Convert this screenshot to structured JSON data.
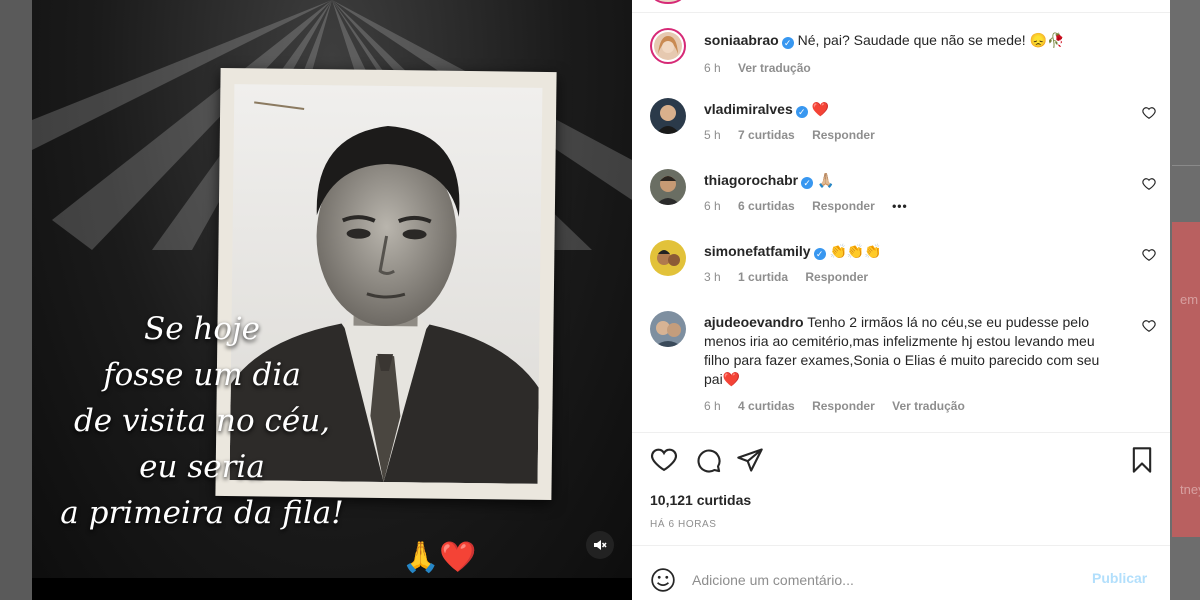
{
  "post": {
    "author": "soniaabrao",
    "caption": "Né, pai? Saudade que não se mede! 😞🥀",
    "time": "6 h",
    "translate": "Ver tradução",
    "overlay_lines": [
      "Se hoje",
      "fosse um dia",
      "de visita no céu,",
      "eu seria",
      "a primeira da fila!"
    ],
    "emojis": "🙏❤️"
  },
  "comments": [
    {
      "username": "vladimiralves",
      "verified": true,
      "text": "❤️",
      "time": "5 h",
      "likes": "7 curtidas",
      "reply": "Responder",
      "extra": ""
    },
    {
      "username": "thiagorochabr",
      "verified": true,
      "text": "🙏🏼",
      "time": "6 h",
      "likes": "6 curtidas",
      "reply": "Responder",
      "extra": "•••"
    },
    {
      "username": "simonefatfamily",
      "verified": true,
      "text": "👏👏👏",
      "time": "3 h",
      "likes": "1 curtida",
      "reply": "Responder",
      "extra": ""
    },
    {
      "username": "ajudeoevandro",
      "verified": false,
      "text": "Tenho 2 irmãos lá no céu,se eu pudesse pelo menos iria ao cemitério,mas infelizmente hj estou levando meu filho para fazer exames,Sonia o Elias é muito parecido com seu pai❤️",
      "time": "6 h",
      "likes": "4 curtidas",
      "reply": "Responder",
      "extra": "Ver tradução"
    }
  ],
  "likes_total": "10,121 curtidas",
  "posted_ago": "HÁ 6 HORAS",
  "add_comment": {
    "placeholder": "Adicione um comentário...",
    "publish": "Publicar"
  },
  "background_fragments": [
    "em",
    "tney"
  ],
  "colors": {
    "verified": "#3897f0",
    "publish_disabled": "#b2dffc",
    "muted_text": "#8e8e8e"
  }
}
